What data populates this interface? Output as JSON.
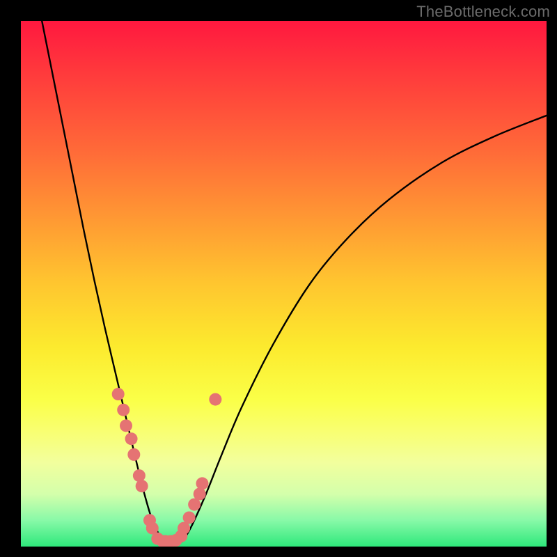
{
  "watermark": "TheBottleneck.com",
  "colors": {
    "background": "#000000",
    "curve_stroke": "#000000",
    "marker_fill": "#e57373",
    "marker_stroke": "#c95a5a",
    "watermark_text": "#6b6b6b"
  },
  "chart_data": {
    "type": "line",
    "title": "",
    "xlabel": "",
    "ylabel": "",
    "xlim": [
      0,
      100
    ],
    "ylim": [
      0,
      100
    ],
    "gradient_stops": [
      {
        "pos": 0,
        "color": "#ff183f"
      },
      {
        "pos": 10,
        "color": "#ff3a3c"
      },
      {
        "pos": 25,
        "color": "#ff6b38"
      },
      {
        "pos": 38,
        "color": "#ff9a33"
      },
      {
        "pos": 50,
        "color": "#ffc62f"
      },
      {
        "pos": 62,
        "color": "#fcea2e"
      },
      {
        "pos": 72,
        "color": "#faff47"
      },
      {
        "pos": 78,
        "color": "#f9ff71"
      },
      {
        "pos": 84,
        "color": "#f2ff9d"
      },
      {
        "pos": 90,
        "color": "#d4ffab"
      },
      {
        "pos": 95,
        "color": "#88f9a8"
      },
      {
        "pos": 100,
        "color": "#2ee87b"
      }
    ],
    "series": [
      {
        "name": "bottleneck-curve",
        "x": [
          4.0,
          6.0,
          8.0,
          10.0,
          12.0,
          14.0,
          16.0,
          18.0,
          20.0,
          22.0,
          23.5,
          25.0,
          26.5,
          28.0,
          30.0,
          32.0,
          35.0,
          38.0,
          42.0,
          48.0,
          55.0,
          62.0,
          70.0,
          80.0,
          90.0,
          100.0
        ],
        "y": [
          100.0,
          90.0,
          80.0,
          70.0,
          60.0,
          50.5,
          41.5,
          33.0,
          24.5,
          16.0,
          10.0,
          5.0,
          2.0,
          0.5,
          0.5,
          3.0,
          9.5,
          17.0,
          26.5,
          38.5,
          50.0,
          58.5,
          66.0,
          73.0,
          78.0,
          82.0
        ]
      }
    ],
    "markers": {
      "name": "highlighted-data-points",
      "x": [
        18.5,
        19.5,
        20.0,
        21.0,
        21.5,
        22.5,
        23.0,
        24.5,
        25.0,
        26.0,
        27.0,
        27.5,
        28.5,
        29.5,
        30.5,
        31.0,
        32.0,
        33.0,
        34.0,
        34.5,
        37.0
      ],
      "y": [
        29.0,
        26.0,
        23.0,
        20.5,
        17.5,
        13.5,
        11.5,
        5.0,
        3.5,
        1.5,
        1.0,
        1.0,
        1.0,
        1.2,
        2.0,
        3.5,
        5.5,
        8.0,
        10.0,
        12.0,
        28.0
      ]
    }
  }
}
